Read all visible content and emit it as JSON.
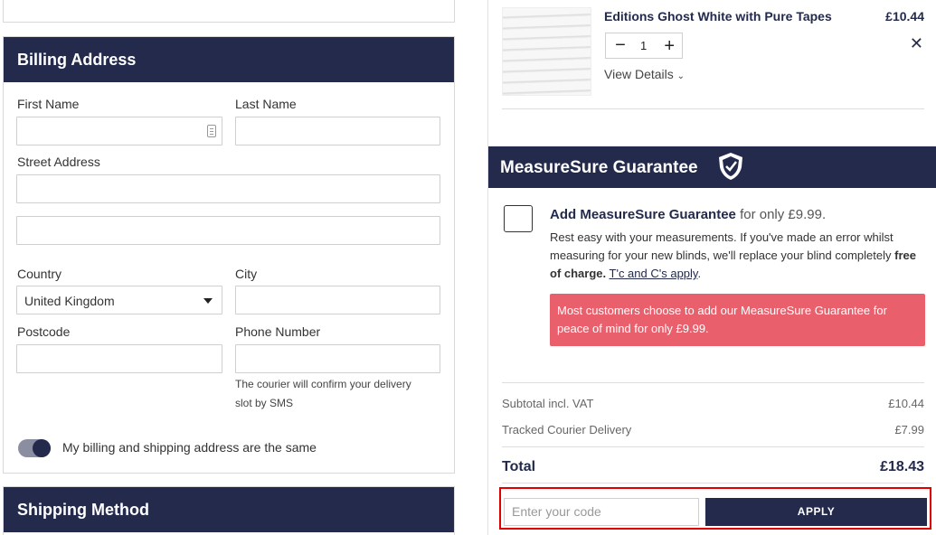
{
  "billing": {
    "title": "Billing Address",
    "first_name_label": "First Name",
    "last_name_label": "Last Name",
    "street_label": "Street Address",
    "country_label": "Country",
    "country_value": "United Kingdom",
    "city_label": "City",
    "postcode_label": "Postcode",
    "phone_label": "Phone Number",
    "phone_hint_1": "The courier will confirm your delivery",
    "phone_hint_2": "slot by SMS",
    "same_address_label": "My billing and shipping address are the same"
  },
  "shipping": {
    "title": "Shipping Method"
  },
  "cart": {
    "item_title": "Editions Ghost White with Pure Tapes",
    "item_price": "£10.44",
    "quantity": "1",
    "view_details": "View Details"
  },
  "guarantee": {
    "header": "MeasureSure Guarantee",
    "add_bold": "Add MeasureSure Guarantee",
    "add_suffix": "for only £9.99.",
    "body_1": "Rest easy with your measurements. If you've made an error whilst measuring for your new blinds, we'll replace your blind completely",
    "body_bold": "free of charge.",
    "body_link": "T'c and C's apply",
    "body_end": ".",
    "alert": "Most customers choose to add our MeasureSure Guarantee for peace of mind for only £9.99."
  },
  "summary": {
    "subtotal_label": "Subtotal incl. VAT",
    "subtotal_value": "£10.44",
    "delivery_label": "Tracked Courier Delivery",
    "delivery_value": "£7.99",
    "total_label": "Total",
    "total_value": "£18.43"
  },
  "promo": {
    "placeholder": "Enter your code",
    "apply_label": "APPLY"
  },
  "colors": {
    "navy": "#232a4c",
    "alert": "#e9606c",
    "highlight": "#e00000"
  }
}
